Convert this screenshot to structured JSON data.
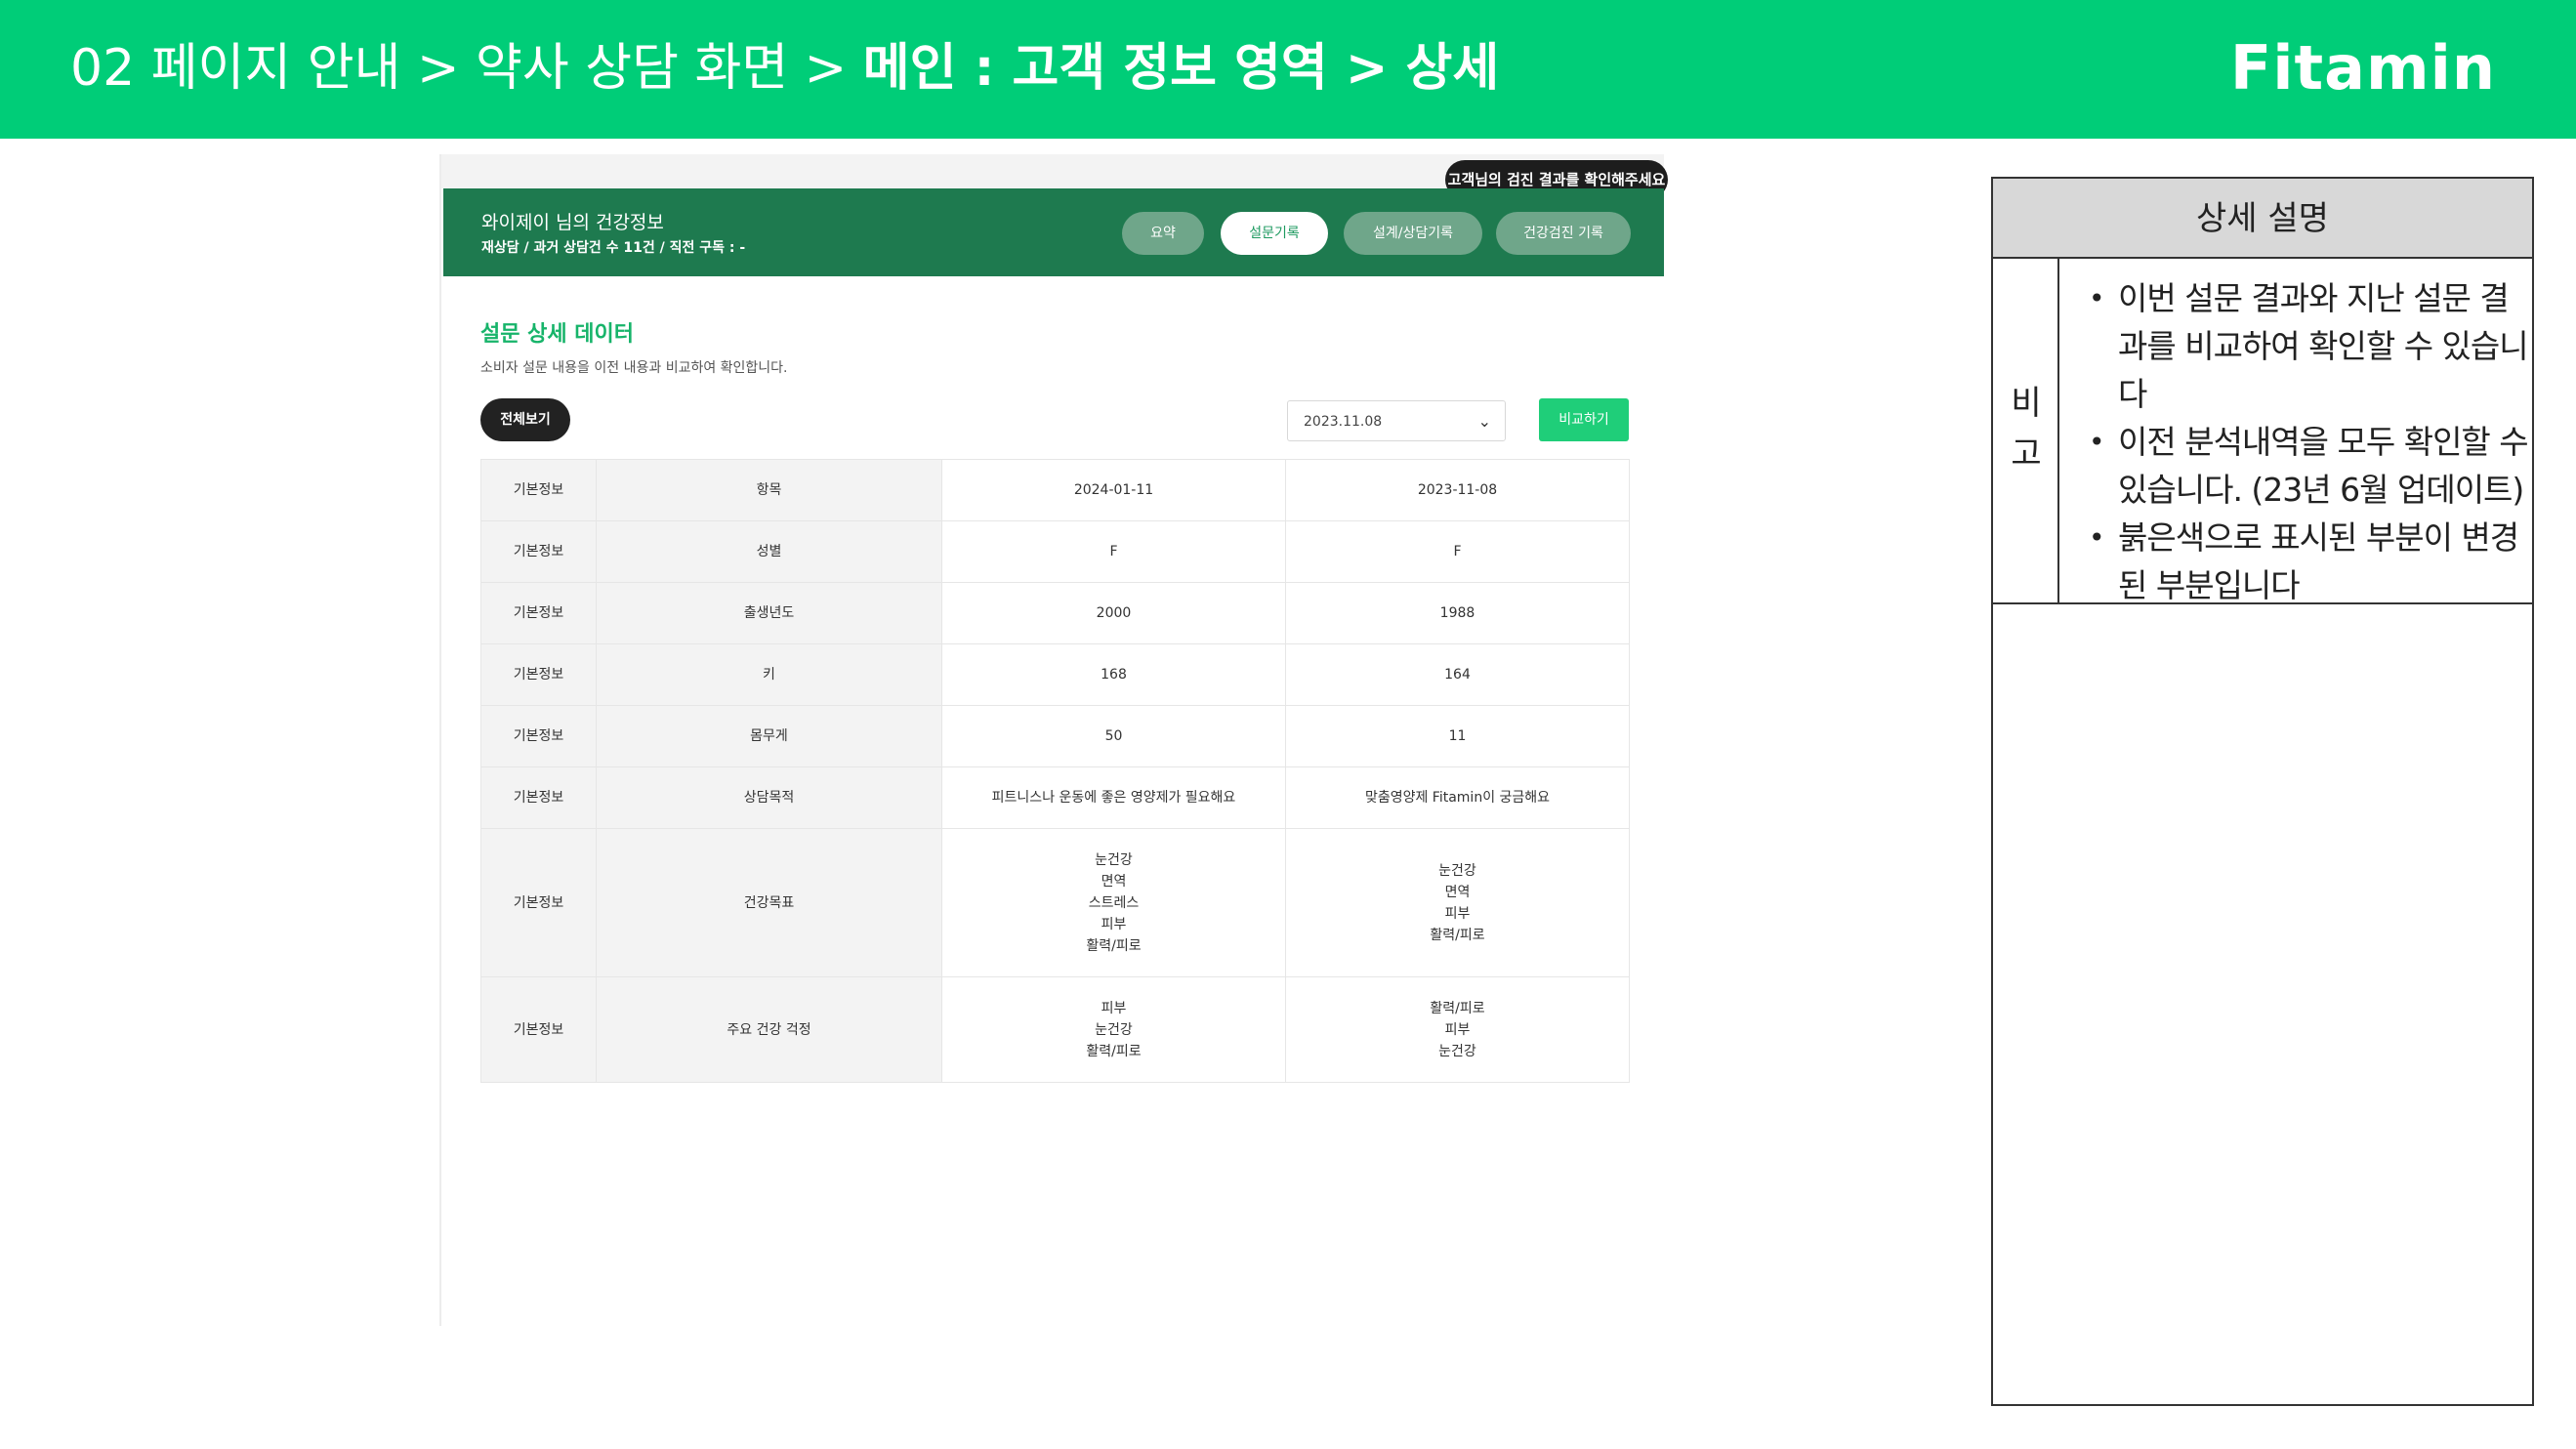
{
  "banner": {
    "breadcrumb_prefix": "02 페이지 안내 > 약사 상담 화면 > ",
    "breadcrumb_strong": "메인 : 고객 정보 영역 > 상세",
    "brand": "Fitamin",
    "bg_color": "#00cd78"
  },
  "app": {
    "tooltip": "고객님의 검진 결과를 확인해주세요",
    "header": {
      "title": "와이제이 님의 건강정보",
      "subtitle": "재상담 / 과거 상담건 수 11건 / 직전 구독 : -",
      "tabs": [
        {
          "label": "요약",
          "active": false
        },
        {
          "label": "설문기록",
          "active": true
        },
        {
          "label": "설계/상담기록",
          "active": false
        },
        {
          "label": "건강검진 기록",
          "active": false
        }
      ]
    },
    "section": {
      "title": "설문 상세 데이터",
      "description": "소비자 설문 내용을 이전 내용과 비교하여 확인합니다.",
      "view_all_label": "전체보기",
      "date_select_value": "2023.11.08",
      "compare_label": "비교하기"
    },
    "table": {
      "rows": [
        {
          "category": "기본정보",
          "item": "항목",
          "v1": [
            "2024-01-11"
          ],
          "v2": [
            "2023-11-08"
          ],
          "v1_red": false
        },
        {
          "category": "기본정보",
          "item": "성별",
          "v1": [
            "F"
          ],
          "v2": [
            "F"
          ],
          "v1_red": false
        },
        {
          "category": "기본정보",
          "item": "출생년도",
          "v1": [
            "2000"
          ],
          "v2": [
            "1988"
          ],
          "v1_red": true
        },
        {
          "category": "기본정보",
          "item": "키",
          "v1": [
            "168"
          ],
          "v2": [
            "164"
          ],
          "v1_red": true
        },
        {
          "category": "기본정보",
          "item": "몸무게",
          "v1": [
            "50"
          ],
          "v2": [
            "11"
          ],
          "v1_red": true
        },
        {
          "category": "기본정보",
          "item": "상담목적",
          "v1": [
            "피트니스나 운동에 좋은 영양제가 필요해요"
          ],
          "v2": [
            "맞춤영양제 Fitamin이 궁금해요"
          ],
          "v1_red": true
        },
        {
          "category": "기본정보",
          "item": "건강목표",
          "v1": [
            "눈건강",
            "면역",
            "스트레스",
            "피부",
            "활력/피로"
          ],
          "v2": [
            "눈건강",
            "면역",
            "피부",
            "활력/피로"
          ],
          "v1_red": true
        },
        {
          "category": "기본정보",
          "item": "주요 건강 걱정",
          "v1": [
            "피부",
            "눈건강",
            "활력/피로"
          ],
          "v2": [
            "활력/피로",
            "피부",
            "눈건강"
          ],
          "v1_red": true
        }
      ]
    }
  },
  "panel": {
    "title": "상세 설명",
    "label_chars": [
      "비",
      "고"
    ],
    "notes": [
      "이번 설문 결과와 지난 설문 결과를 비교하여 확인할 수 있습니다",
      "이전 분석내역을 모두 확인할 수 있습니다. (23년 6월 업데이트)",
      "붉은색으로 표시된 부분이 변경된 부분입니다"
    ]
  }
}
